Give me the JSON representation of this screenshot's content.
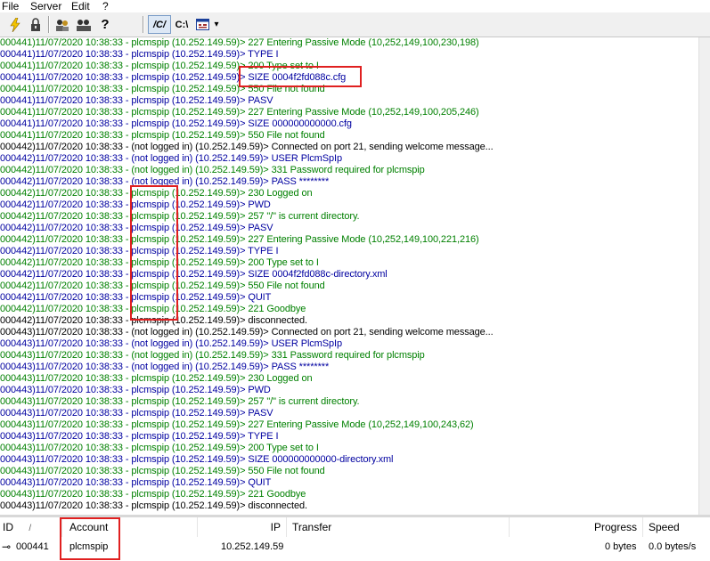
{
  "menubar": {
    "items": [
      "File",
      "Server",
      "Edit",
      "?"
    ]
  },
  "toolbar": {
    "buttons": [
      {
        "icon": "lightning-icon",
        "glyph": "⚡"
      },
      {
        "icon": "lock-icon",
        "glyph": "🔒"
      },
      {
        "icon": "users-icon",
        "glyph": "👥"
      },
      {
        "icon": "groups-icon",
        "glyph": "👥"
      },
      {
        "icon": "help-icon",
        "glyph": "?"
      },
      {
        "icon": "unix-path-icon",
        "glyph": "/C/"
      },
      {
        "icon": "dos-path-icon",
        "glyph": "C:\\"
      },
      {
        "icon": "window-icon",
        "glyph": "▦"
      },
      {
        "icon": "dropdown-arrow-icon",
        "glyph": "▾"
      }
    ]
  },
  "colors": {
    "reply": "#008000",
    "command": "#0000a0",
    "info": "#000000",
    "highlight": "#e02020"
  },
  "log": [
    {
      "type": "reply",
      "text": "000441)11/07/2020 10:38:33 - plcmspip (10.252.149.59)> 227 Entering Passive Mode (10,252,149,100,230,198)"
    },
    {
      "type": "cmd",
      "text": "000441)11/07/2020 10:38:33 - plcmspip (10.252.149.59)> TYPE I"
    },
    {
      "type": "reply",
      "text": "000441)11/07/2020 10:38:33 - plcmspip (10.252.149.59)> 200 Type set to I"
    },
    {
      "type": "cmd",
      "text": "000441)11/07/2020 10:38:33 - plcmspip (10.252.149.59)> SIZE 0004f2fd088c.cfg"
    },
    {
      "type": "reply",
      "text": "000441)11/07/2020 10:38:33 - plcmspip (10.252.149.59)> 550 File not found"
    },
    {
      "type": "cmd",
      "text": "000441)11/07/2020 10:38:33 - plcmspip (10.252.149.59)> PASV"
    },
    {
      "type": "reply",
      "text": "000441)11/07/2020 10:38:33 - plcmspip (10.252.149.59)> 227 Entering Passive Mode (10,252,149,100,205,246)"
    },
    {
      "type": "cmd",
      "text": "000441)11/07/2020 10:38:33 - plcmspip (10.252.149.59)> SIZE 000000000000.cfg"
    },
    {
      "type": "reply",
      "text": "000441)11/07/2020 10:38:33 - plcmspip (10.252.149.59)> 550 File not found"
    },
    {
      "type": "info",
      "text": "000442)11/07/2020 10:38:33 - (not logged in) (10.252.149.59)> Connected on port 21, sending welcome message..."
    },
    {
      "type": "cmd",
      "text": "000442)11/07/2020 10:38:33 - (not logged in) (10.252.149.59)> USER PlcmSpIp"
    },
    {
      "type": "reply",
      "text": "000442)11/07/2020 10:38:33 - (not logged in) (10.252.149.59)> 331 Password required for plcmspip"
    },
    {
      "type": "cmd",
      "text": "000442)11/07/2020 10:38:33 - (not logged in) (10.252.149.59)> PASS ********"
    },
    {
      "type": "reply",
      "text": "000442)11/07/2020 10:38:33 - plcmspip (10.252.149.59)> 230 Logged on"
    },
    {
      "type": "cmd",
      "text": "000442)11/07/2020 10:38:33 - plcmspip (10.252.149.59)> PWD"
    },
    {
      "type": "reply",
      "text": "000442)11/07/2020 10:38:33 - plcmspip (10.252.149.59)> 257 \"/\" is current directory."
    },
    {
      "type": "cmd",
      "text": "000442)11/07/2020 10:38:33 - plcmspip (10.252.149.59)> PASV"
    },
    {
      "type": "reply",
      "text": "000442)11/07/2020 10:38:33 - plcmspip (10.252.149.59)> 227 Entering Passive Mode (10,252,149,100,221,216)"
    },
    {
      "type": "cmd",
      "text": "000442)11/07/2020 10:38:33 - plcmspip (10.252.149.59)> TYPE I"
    },
    {
      "type": "reply",
      "text": "000442)11/07/2020 10:38:33 - plcmspip (10.252.149.59)> 200 Type set to I"
    },
    {
      "type": "cmd",
      "text": "000442)11/07/2020 10:38:33 - plcmspip (10.252.149.59)> SIZE 0004f2fd088c-directory.xml"
    },
    {
      "type": "reply",
      "text": "000442)11/07/2020 10:38:33 - plcmspip (10.252.149.59)> 550 File not found"
    },
    {
      "type": "cmd",
      "text": "000442)11/07/2020 10:38:33 - plcmspip (10.252.149.59)> QUIT"
    },
    {
      "type": "reply",
      "text": "000442)11/07/2020 10:38:33 - plcmspip (10.252.149.59)> 221 Goodbye"
    },
    {
      "type": "info",
      "text": "000442)11/07/2020 10:38:33 - plcmspip (10.252.149.59)> disconnected."
    },
    {
      "type": "info",
      "text": "000443)11/07/2020 10:38:33 - (not logged in) (10.252.149.59)> Connected on port 21, sending welcome message..."
    },
    {
      "type": "cmd",
      "text": "000443)11/07/2020 10:38:33 - (not logged in) (10.252.149.59)> USER PlcmSpIp"
    },
    {
      "type": "reply",
      "text": "000443)11/07/2020 10:38:33 - (not logged in) (10.252.149.59)> 331 Password required for plcmspip"
    },
    {
      "type": "cmd",
      "text": "000443)11/07/2020 10:38:33 - (not logged in) (10.252.149.59)> PASS ********"
    },
    {
      "type": "reply",
      "text": "000443)11/07/2020 10:38:33 - plcmspip (10.252.149.59)> 230 Logged on"
    },
    {
      "type": "cmd",
      "text": "000443)11/07/2020 10:38:33 - plcmspip (10.252.149.59)> PWD"
    },
    {
      "type": "reply",
      "text": "000443)11/07/2020 10:38:33 - plcmspip (10.252.149.59)> 257 \"/\" is current directory."
    },
    {
      "type": "cmd",
      "text": "000443)11/07/2020 10:38:33 - plcmspip (10.252.149.59)> PASV"
    },
    {
      "type": "reply",
      "text": "000443)11/07/2020 10:38:33 - plcmspip (10.252.149.59)> 227 Entering Passive Mode (10,252,149,100,243,62)"
    },
    {
      "type": "cmd",
      "text": "000443)11/07/2020 10:38:33 - plcmspip (10.252.149.59)> TYPE I"
    },
    {
      "type": "reply",
      "text": "000443)11/07/2020 10:38:33 - plcmspip (10.252.149.59)> 200 Type set to I"
    },
    {
      "type": "cmd",
      "text": "000443)11/07/2020 10:38:33 - plcmspip (10.252.149.59)> SIZE 000000000000-directory.xml"
    },
    {
      "type": "reply",
      "text": "000443)11/07/2020 10:38:33 - plcmspip (10.252.149.59)> 550 File not found"
    },
    {
      "type": "cmd",
      "text": "000443)11/07/2020 10:38:33 - plcmspip (10.252.149.59)> QUIT"
    },
    {
      "type": "reply",
      "text": "000443)11/07/2020 10:38:33 - plcmspip (10.252.149.59)> 221 Goodbye"
    },
    {
      "type": "info",
      "text": "000443)11/07/2020 10:38:33 - plcmspip (10.252.149.59)> disconnected."
    }
  ],
  "sessions": {
    "columns": {
      "id": "ID",
      "sort": "/",
      "account": "Account",
      "ip": "IP",
      "transfer": "Transfer",
      "progress": "Progress",
      "speed": "Speed"
    },
    "rows": [
      {
        "id": "000441",
        "account": "plcmspip",
        "ip": "10.252.149.59",
        "transfer": "",
        "progress": "0 bytes",
        "speed": "0.0 bytes/s"
      }
    ]
  }
}
